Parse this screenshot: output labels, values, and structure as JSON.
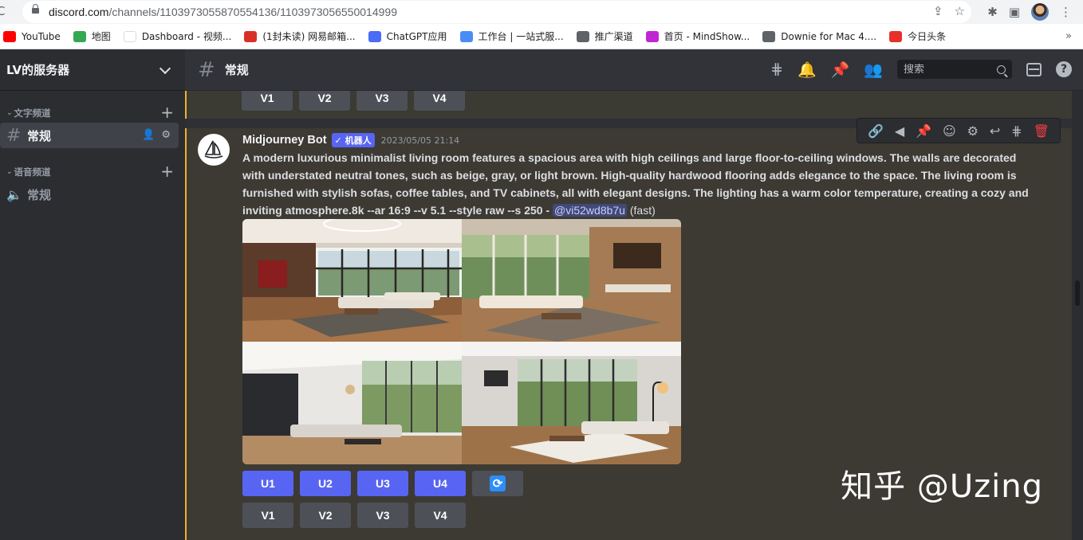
{
  "browser": {
    "url_host": "discord.com",
    "url_path": "/channels/1103973055870554136/1103973056550014999",
    "bookmarks": [
      {
        "label": "YouTube",
        "color": "#ff0000"
      },
      {
        "label": "地图",
        "color": "#34a853"
      },
      {
        "label": "Dashboard - 视频...",
        "color": "#ffffff"
      },
      {
        "label": "(1封未读) 网易邮箱...",
        "color": "#d93025"
      },
      {
        "label": "ChatGPT应用",
        "color": "#4a6cf7"
      },
      {
        "label": "工作台 | 一站式服...",
        "color": "#4a8cf7"
      },
      {
        "label": "推广渠道",
        "color": "#5f6368"
      },
      {
        "label": "首页 - MindShow...",
        "color": "#c026d3"
      },
      {
        "label": "Downie for Mac 4....",
        "color": "#5f6368"
      },
      {
        "label": "今日头条",
        "color": "#e8302a"
      }
    ]
  },
  "server": {
    "name": "LV的服务器",
    "categories": {
      "text": "文字频道",
      "voice": "语音频道"
    },
    "text_channel": "常规",
    "voice_channel": "常规"
  },
  "channel": {
    "title": "常规",
    "search_placeholder": "搜索"
  },
  "previous_message": {
    "buttons": [
      "V1",
      "V2",
      "V3",
      "V4"
    ]
  },
  "message": {
    "author": "Midjourney Bot",
    "bot_tag": "✓ 机器人",
    "timestamp": "2023/05/05 21:14",
    "prompt": "A modern luxurious minimalist living room features a spacious area with high ceilings and large floor-to-ceiling windows. The walls are decorated with understated neutral tones, such as beige, gray, or light brown. High-quality hardwood flooring adds elegance to the space. The living room is furnished with stylish sofas, coffee tables, and TV cabinets, all with elegant designs. The lighting has a warm color temperature, creating a cozy and inviting atmosphere.8k --ar 16:9 --v 5.1 --style raw --s 250",
    "separator": " - ",
    "mention": "@vi52wd8b7u",
    "speed": "(fast)",
    "upscale_buttons": [
      "U1",
      "U2",
      "U3",
      "U4"
    ],
    "variation_buttons": [
      "V1",
      "V2",
      "V3",
      "V4"
    ]
  },
  "watermark": "知乎 @Uzing",
  "colors": {
    "blurple": "#5865f2",
    "highlight_border": "#f0b232",
    "danger": "#f23f43"
  }
}
